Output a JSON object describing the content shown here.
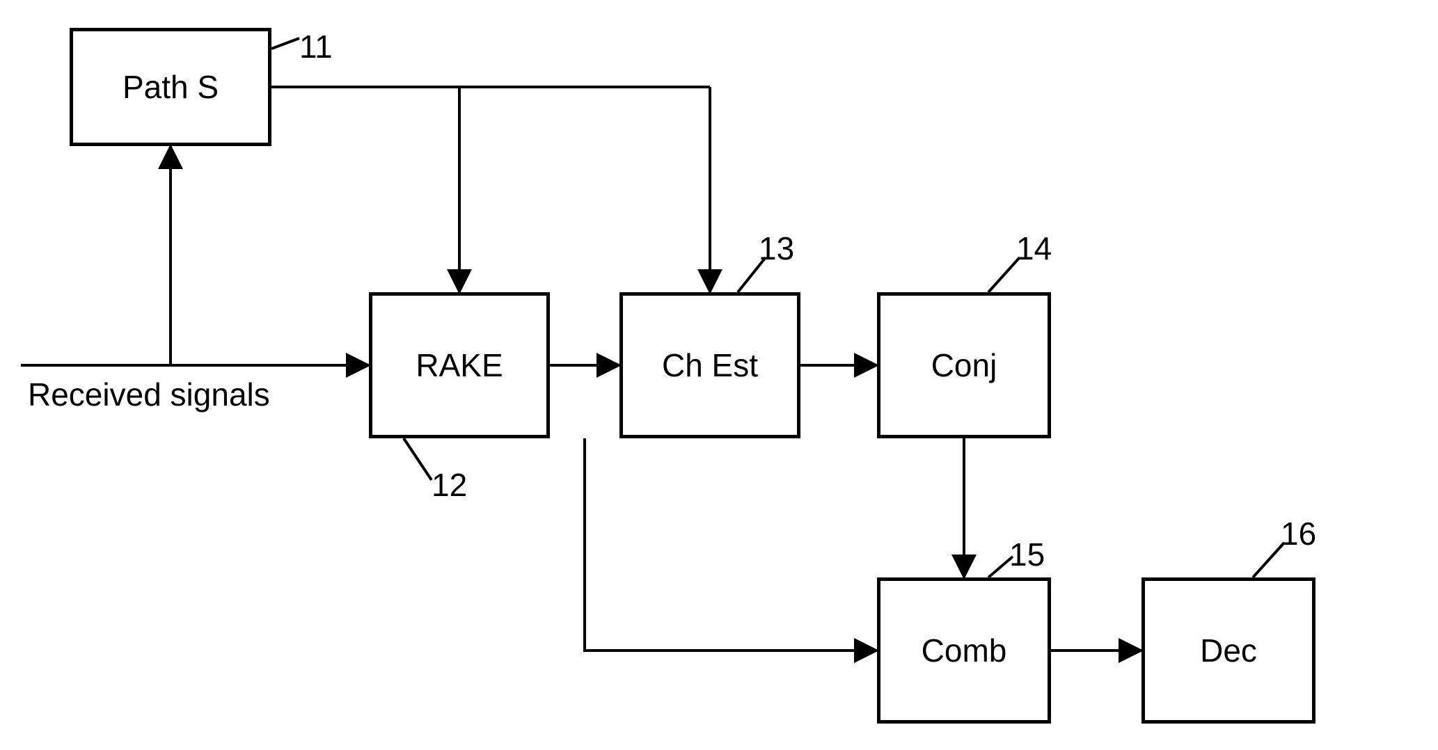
{
  "diagram": {
    "input_label": "Received signals",
    "blocks": {
      "path_s": {
        "label": "Path S",
        "ref": "11"
      },
      "rake": {
        "label": "RAKE",
        "ref": "12"
      },
      "ch_est": {
        "label": "Ch Est",
        "ref": "13"
      },
      "conj": {
        "label": "Conj",
        "ref": "14"
      },
      "comb": {
        "label": "Comb",
        "ref": "15"
      },
      "dec": {
        "label": "Dec",
        "ref": "16"
      }
    },
    "connections": [
      {
        "from": "input",
        "to": "rake"
      },
      {
        "from": "input",
        "to": "path_s"
      },
      {
        "from": "path_s",
        "to": "rake"
      },
      {
        "from": "path_s",
        "to": "ch_est"
      },
      {
        "from": "rake",
        "to": "ch_est"
      },
      {
        "from": "rake",
        "to": "comb"
      },
      {
        "from": "ch_est",
        "to": "conj"
      },
      {
        "from": "conj",
        "to": "comb"
      },
      {
        "from": "comb",
        "to": "dec"
      }
    ]
  }
}
